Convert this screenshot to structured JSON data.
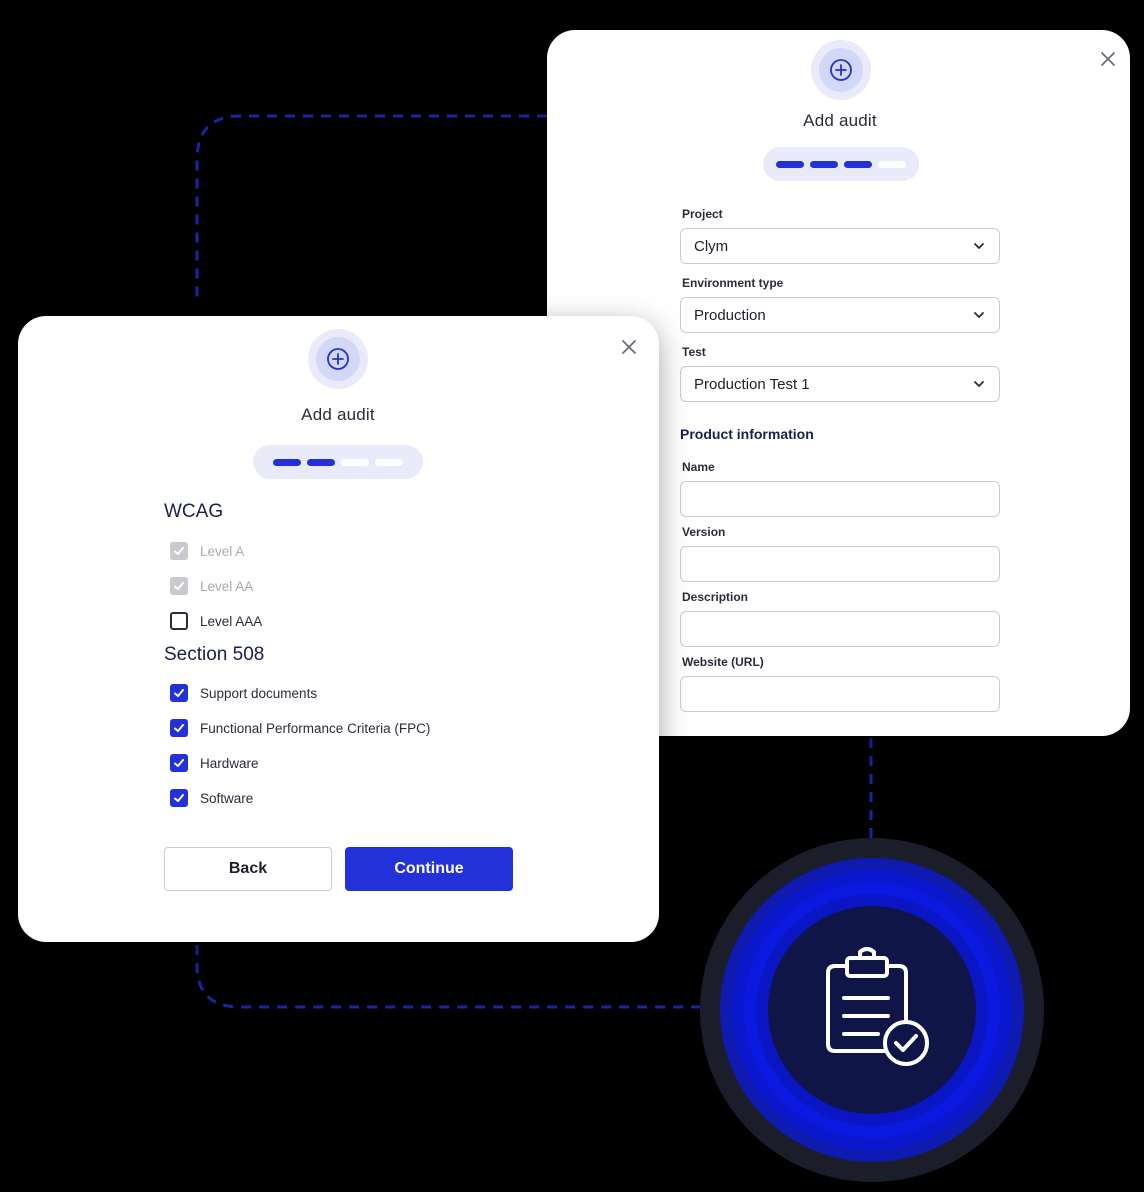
{
  "colors": {
    "accent": "#2331d9",
    "background": "#000000",
    "emblem_inner": "#0f1547"
  },
  "back_dialog": {
    "title": "Add audit",
    "steps_total": 4,
    "steps_completed": 3,
    "project": {
      "label": "Project",
      "value": "Clym"
    },
    "environment_type": {
      "label": "Environment type",
      "value": "Production"
    },
    "test": {
      "label": "Test",
      "value": "Production Test 1"
    },
    "product_information": {
      "heading": "Product information",
      "name": {
        "label": "Name",
        "value": ""
      },
      "version": {
        "label": "Version",
        "value": ""
      },
      "description": {
        "label": "Description",
        "value": ""
      },
      "website": {
        "label": "Website (URL)",
        "value": ""
      }
    },
    "icons": {
      "close": "close-icon",
      "add": "plus-circle-icon",
      "dropdown": "chevron-down-icon"
    }
  },
  "front_dialog": {
    "title": "Add audit",
    "steps_total": 4,
    "steps_completed": 2,
    "wcag": {
      "title": "WCAG",
      "options": [
        {
          "label": "Level A",
          "checked": true,
          "disabled": true
        },
        {
          "label": "Level AA",
          "checked": true,
          "disabled": true
        },
        {
          "label": "Level AAA",
          "checked": false,
          "disabled": false
        }
      ]
    },
    "section508": {
      "title": "Section 508",
      "options": [
        {
          "label": "Support documents",
          "checked": true
        },
        {
          "label": "Functional Performance Criteria (FPC)",
          "checked": true
        },
        {
          "label": "Hardware",
          "checked": true
        },
        {
          "label": "Software",
          "checked": true
        }
      ]
    },
    "back_label": "Back",
    "continue_label": "Continue",
    "icons": {
      "close": "close-icon",
      "add": "plus-circle-icon"
    }
  },
  "emblem": {
    "icon": "clipboard-check-icon"
  }
}
